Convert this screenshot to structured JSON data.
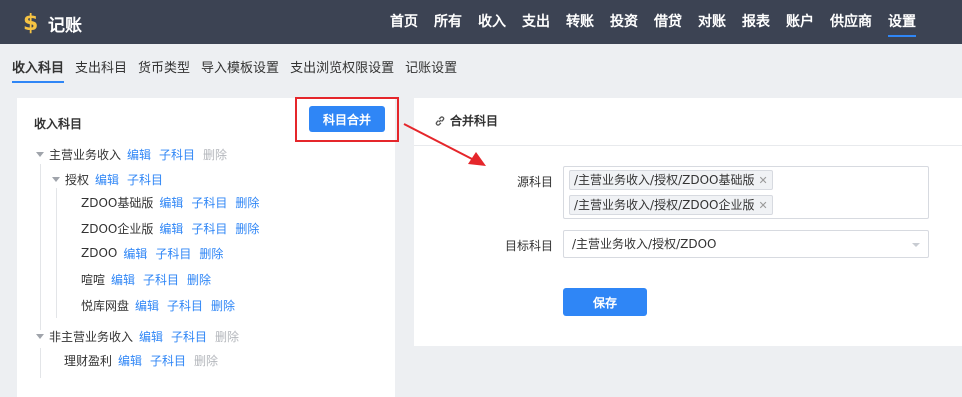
{
  "app": {
    "title": "记账",
    "logo_icon": "dollar-icon"
  },
  "nav": {
    "items": [
      {
        "label": "首页"
      },
      {
        "label": "所有"
      },
      {
        "label": "收入"
      },
      {
        "label": "支出"
      },
      {
        "label": "转账"
      },
      {
        "label": "投资"
      },
      {
        "label": "借贷"
      },
      {
        "label": "对账"
      },
      {
        "label": "报表"
      },
      {
        "label": "账户"
      },
      {
        "label": "供应商"
      },
      {
        "label": "设置",
        "active": true
      }
    ]
  },
  "subnav": {
    "items": [
      {
        "label": "收入科目",
        "active": true
      },
      {
        "label": "支出科目"
      },
      {
        "label": "货币类型"
      },
      {
        "label": "导入模板设置"
      },
      {
        "label": "支出浏览权限设置"
      },
      {
        "label": "记账设置"
      }
    ]
  },
  "left": {
    "title": "收入科目",
    "merge_button": "科目合并",
    "actions": {
      "edit": "编辑",
      "child": "子科目",
      "delete": "删除"
    },
    "tree": [
      {
        "label": "主营业务收入",
        "delete_enabled": false
      },
      {
        "label": "授权",
        "no_delete": true
      },
      {
        "label": "ZDOO基础版",
        "delete_enabled": true
      },
      {
        "label": "ZDOO企业版",
        "delete_enabled": true
      },
      {
        "label": "ZDOO",
        "delete_enabled": true
      },
      {
        "label": "喧喧",
        "delete_enabled": true
      },
      {
        "label": "悦库网盘",
        "delete_enabled": true
      },
      {
        "label": "非主营业务收入",
        "delete_enabled": false
      },
      {
        "label": "理财盈利",
        "delete_enabled": false
      }
    ]
  },
  "right": {
    "title": "合并科目",
    "title_icon": "link-icon",
    "source_label": "源科目",
    "source_tags": [
      "/主营业务收入/授权/ZDOO基础版",
      "/主营业务收入/授权/ZDOO企业版"
    ],
    "target_label": "目标科目",
    "target_value": "/主营业务收入/授权/ZDOO",
    "save_button": "保存"
  },
  "colors": {
    "topbar": "#3c4353",
    "accent": "#2f86f6",
    "annotation": "#e5262b"
  }
}
